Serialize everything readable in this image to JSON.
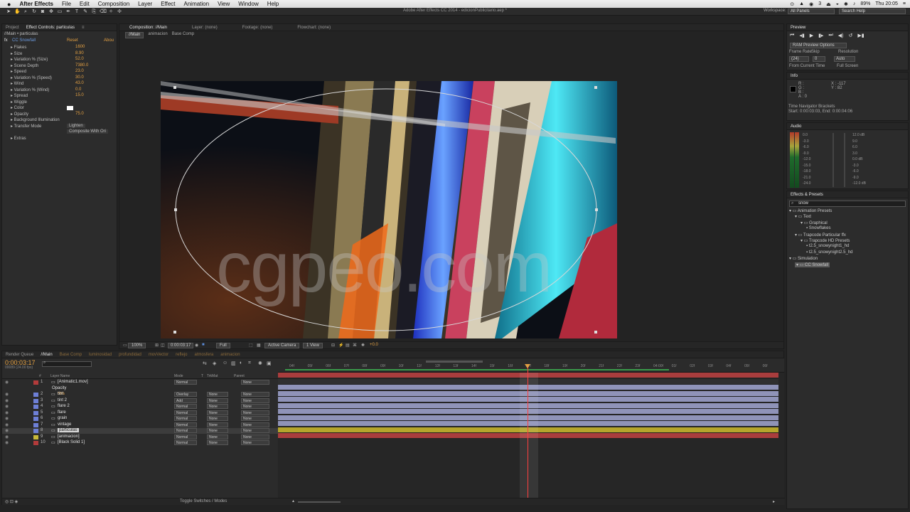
{
  "menubar": {
    "app": "After Effects",
    "items": [
      "File",
      "Edit",
      "Composition",
      "Layer",
      "Effect",
      "Animation",
      "View",
      "Window",
      "Help"
    ],
    "status": [
      "⊙",
      "▲",
      "◉",
      "3",
      "⏏",
      "◒",
      "✱",
      "♪",
      "89%",
      "Thu 20:05",
      "≡"
    ]
  },
  "window_title": "Adobe After Effects CC 2014 - edicionPublicitario.aep *",
  "workspace": {
    "label": "Workspace:",
    "value": "All Panels",
    "search": "Search Help"
  },
  "project_panel": {
    "tabs": [
      "Project",
      "Effect Controls: particulas",
      "≡"
    ],
    "breadcrumb": "//Main • particulas",
    "effect": {
      "name": "CC Snowfall",
      "reset": "Reset",
      "about": "Abou"
    },
    "props": [
      {
        "name": "Flakes",
        "value": "1600"
      },
      {
        "name": "Size",
        "value": "8.90"
      },
      {
        "name": "Variation % (Size)",
        "value": "52.0"
      },
      {
        "name": "Scene Depth",
        "value": "7380.0"
      },
      {
        "name": "Speed",
        "value": "23.0"
      },
      {
        "name": "Variation % (Speed)",
        "value": "30.0"
      },
      {
        "name": "Wind",
        "value": "43.0"
      },
      {
        "name": "Variation % (Wind)",
        "value": "0.0"
      },
      {
        "name": "Spread",
        "value": "15.0"
      },
      {
        "name": "Wiggle",
        "value": ""
      },
      {
        "name": "Color",
        "value": ""
      },
      {
        "name": "Opacity",
        "value": "75.0"
      },
      {
        "name": "Background Illumination",
        "value": ""
      },
      {
        "name": "Transfer Mode",
        "value": "Lighten"
      },
      {
        "name": "",
        "value": "Composite With Ori"
      },
      {
        "name": "Extras",
        "value": ""
      }
    ]
  },
  "comp_panel": {
    "tabs": [
      "Composition: //Main",
      "Layer: (none)",
      "Footage: (none)",
      "Flowchart: (none)"
    ],
    "subtabs": [
      "//Main",
      "animacion",
      "Base Comp"
    ],
    "watermark": "cgpeo.com",
    "footer": [
      "100%",
      "0:00:03:17",
      "Full",
      "Active Camera",
      "1 View",
      "+0.0"
    ]
  },
  "preview": {
    "title": "Preview",
    "options": "RAM Preview Options",
    "labels": [
      "Frame Rate",
      "Skip",
      "Resolution"
    ],
    "values": [
      "(24)",
      "0",
      "Auto"
    ],
    "checks": [
      "From Current Time",
      "Full Screen"
    ]
  },
  "info": {
    "title": "Info",
    "rgba": [
      "R :",
      "G :",
      "B :",
      "A : 0"
    ],
    "xy": [
      "X : -117",
      "Y : 82"
    ],
    "msg1": "Time Navigator Brackets",
    "msg2": "Start: 0:00:03:03, End: 0:00:04:06"
  },
  "audio": {
    "title": "Audio",
    "left": [
      "0.0",
      "-3.0",
      "-6.0",
      "-9.0",
      "-12.0",
      "-15.0",
      "-18.0",
      "-21.0",
      "-24.0"
    ],
    "right": [
      "12.0 dB",
      "9.0",
      "6.0",
      "3.0",
      "0.0 dB",
      "-3.0",
      "-6.0",
      "-9.0",
      "-12.0 dB"
    ]
  },
  "effects_presets": {
    "title": "Effects & Presets",
    "search": "snow",
    "tree": [
      {
        "label": "Animation Presets",
        "indent": 0
      },
      {
        "label": "Text",
        "indent": 1
      },
      {
        "label": "Graphical",
        "indent": 2
      },
      {
        "label": "Snowflakes",
        "indent": 3
      },
      {
        "label": "Trapcode Particular ffx",
        "indent": 1
      },
      {
        "label": "Trapcode HD Presets",
        "indent": 2
      },
      {
        "label": "t2.5_snowynight1_hd",
        "indent": 3
      },
      {
        "label": "t2.5_snowynight2.5_hd",
        "indent": 3
      },
      {
        "label": "Simulation",
        "indent": 0
      },
      {
        "label": "CC Snowfall",
        "indent": 1
      }
    ]
  },
  "timeline": {
    "tabs": [
      "Render Queue",
      "//Main",
      "Base Comp",
      "luminosidad",
      "profundidad",
      "movVector",
      "reflejo",
      "atmosfera",
      "animacion"
    ],
    "timecode": "0:00:03:17",
    "frames": "00089 (24.00 fps)",
    "headers": [
      "#",
      "Layer Name",
      "Mode",
      "T",
      "TrkMat",
      "Parent"
    ],
    "ticks": [
      "04f",
      "05f",
      "06f",
      "07f",
      "08f",
      "09f",
      "10f",
      "11f",
      "12f",
      "13f",
      "14f",
      "15f",
      "16f",
      "17f",
      "18f",
      "19f",
      "20f",
      "21f",
      "22f",
      "23f",
      "04:00f",
      "01f",
      "02f",
      "03f",
      "04f",
      "05f",
      "06f"
    ],
    "layers": [
      {
        "num": "1",
        "name": "[Animatic1.mov]",
        "mode": "Normal",
        "trk": "",
        "parent": "None",
        "color": "#b23b3b"
      },
      {
        "num": "",
        "name": "Opacity",
        "mode": "",
        "trk": "",
        "parent": "",
        "color": ""
      },
      {
        "num": "2",
        "name": "tint",
        "mode": "Overlay",
        "trk": "None",
        "parent": "None",
        "color": "#6d7fd6"
      },
      {
        "num": "3",
        "name": "tint 2",
        "mode": "Add",
        "trk": "None",
        "parent": "None",
        "color": "#6d7fd6"
      },
      {
        "num": "4",
        "name": "flare 2",
        "mode": "Normal",
        "trk": "None",
        "parent": "None",
        "color": "#6d7fd6"
      },
      {
        "num": "5",
        "name": "flare",
        "mode": "Normal",
        "trk": "None",
        "parent": "None",
        "color": "#6d7fd6"
      },
      {
        "num": "6",
        "name": "grain",
        "mode": "Normal",
        "trk": "None",
        "parent": "None",
        "color": "#6d7fd6"
      },
      {
        "num": "7",
        "name": "vintage",
        "mode": "Normal",
        "trk": "None",
        "parent": "None",
        "color": "#6d7fd6"
      },
      {
        "num": "8",
        "name": "particulas",
        "mode": "Normal",
        "trk": "None",
        "parent": "None",
        "color": "#6d7fd6"
      },
      {
        "num": "9",
        "name": "[animacion]",
        "mode": "Normal",
        "trk": "None",
        "parent": "None",
        "color": "#c8b93a"
      },
      {
        "num": "10",
        "name": "[Black Solid 1]",
        "mode": "Normal",
        "trk": "None",
        "parent": "None",
        "color": "#b23b3b"
      }
    ],
    "opacity_value": "50%",
    "toggle": "Toggle Switches / Modes"
  },
  "colors": {
    "accent": "#e3a043",
    "bar_lavender": "#8f93b8",
    "bar_yellow": "#b5a52c",
    "bar_red": "#a93d3d",
    "playhead": "#ff4040"
  }
}
